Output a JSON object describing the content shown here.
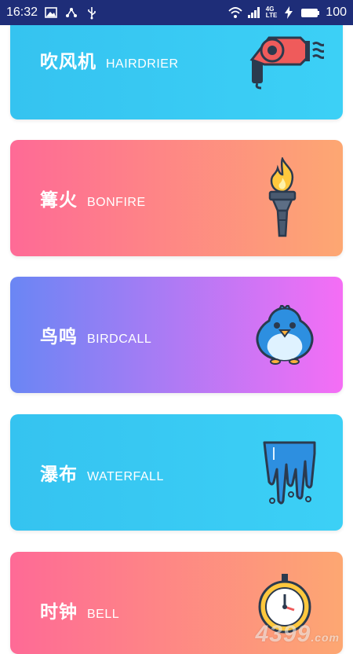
{
  "status_bar": {
    "time": "16:32",
    "network": "4G",
    "network_sub": "LTE",
    "battery": "100"
  },
  "cards": [
    {
      "cn": "吹风机",
      "en": "HAIRDRIER",
      "icon": "hairdryer-icon",
      "gradient": [
        "#35c3f0",
        "#3cd0f6"
      ]
    },
    {
      "cn": "篝火",
      "en": "BONFIRE",
      "icon": "torch-icon",
      "gradient": [
        "#fe6a96",
        "#fda772"
      ]
    },
    {
      "cn": "鸟鸣",
      "en": "BIRDCALL",
      "icon": "bird-icon",
      "gradient": [
        "#6a86f4",
        "#f56ef5"
      ]
    },
    {
      "cn": "瀑布",
      "en": "WATERFALL",
      "icon": "waterfall-icon",
      "gradient": [
        "#35c3f0",
        "#3cd0f6"
      ]
    },
    {
      "cn": "时钟",
      "en": "BELL",
      "icon": "clock-icon",
      "gradient": [
        "#fe6a96",
        "#fda772"
      ]
    }
  ],
  "watermark": {
    "text": "4399",
    "suffix": ".com"
  }
}
